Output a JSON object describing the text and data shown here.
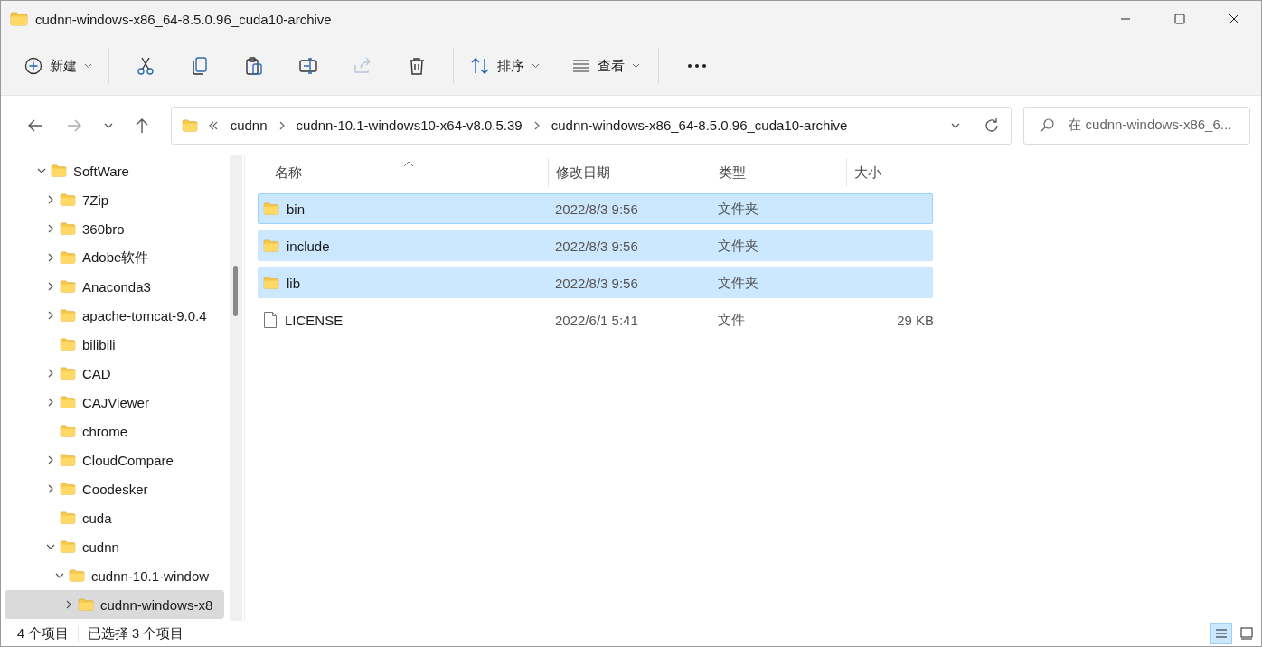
{
  "window": {
    "title": "cudnn-windows-x86_64-8.5.0.96_cuda10-archive"
  },
  "toolbar": {
    "new_label": "新建",
    "sort_label": "排序",
    "view_label": "查看"
  },
  "address": {
    "crumbs": [
      "cudnn",
      "cudnn-10.1-windows10-x64-v8.0.5.39",
      "cudnn-windows-x86_64-8.5.0.96_cuda10-archive"
    ],
    "search_placeholder": "在 cudnn-windows-x86_6..."
  },
  "tree": [
    {
      "label": "SoftWare",
      "expandable": true,
      "expanded": true,
      "selected": false,
      "children": [
        {
          "label": "7Zip",
          "expandable": true,
          "expanded": false,
          "selected": false
        },
        {
          "label": "360bro",
          "expandable": true,
          "expanded": false,
          "selected": false
        },
        {
          "label": "Adobe软件",
          "expandable": true,
          "expanded": false,
          "selected": false
        },
        {
          "label": "Anaconda3",
          "expandable": true,
          "expanded": false,
          "selected": false
        },
        {
          "label": "apache-tomcat-9.0.4",
          "expandable": true,
          "expanded": false,
          "selected": false
        },
        {
          "label": "bilibili",
          "expandable": false,
          "expanded": false,
          "selected": false
        },
        {
          "label": "CAD",
          "expandable": true,
          "expanded": false,
          "selected": false
        },
        {
          "label": "CAJViewer",
          "expandable": true,
          "expanded": false,
          "selected": false
        },
        {
          "label": "chrome",
          "expandable": false,
          "expanded": false,
          "selected": false
        },
        {
          "label": "CloudCompare",
          "expandable": true,
          "expanded": false,
          "selected": false
        },
        {
          "label": "Coodesker",
          "expandable": true,
          "expanded": false,
          "selected": false
        },
        {
          "label": "cuda",
          "expandable": false,
          "expanded": false,
          "selected": false
        },
        {
          "label": "cudnn",
          "expandable": true,
          "expanded": true,
          "selected": false,
          "children": [
            {
              "label": "cudnn-10.1-window",
              "expandable": true,
              "expanded": true,
              "selected": false,
              "children": [
                {
                  "label": "cudnn-windows-x8",
                  "expandable": true,
                  "expanded": false,
                  "selected": true
                }
              ]
            }
          ]
        }
      ]
    }
  ],
  "files": {
    "columns": [
      "名称",
      "修改日期",
      "类型",
      "大小"
    ],
    "rows": [
      {
        "kind": "folder",
        "name": "bin",
        "modified": "2022/8/3 9:56",
        "type": "文件夹",
        "selected": true
      },
      {
        "kind": "folder",
        "name": "include",
        "modified": "2022/8/3 9:56",
        "type": "文件夹",
        "selected": true
      },
      {
        "kind": "folder",
        "name": "lib",
        "modified": "2022/8/3 9:56",
        "type": "文件夹",
        "selected": true
      },
      {
        "kind": "file",
        "name": "LICENSE",
        "modified": "2022/6/1 5:41",
        "type": "文件",
        "size": "29 KB",
        "selected": false
      }
    ]
  },
  "status_bar": {
    "item_count": "4 个项目",
    "selection": "已选择 3 个项目",
    "views": [
      {
        "kind": "details",
        "selected": true
      },
      {
        "kind": "tiles",
        "selected": false
      }
    ]
  }
}
